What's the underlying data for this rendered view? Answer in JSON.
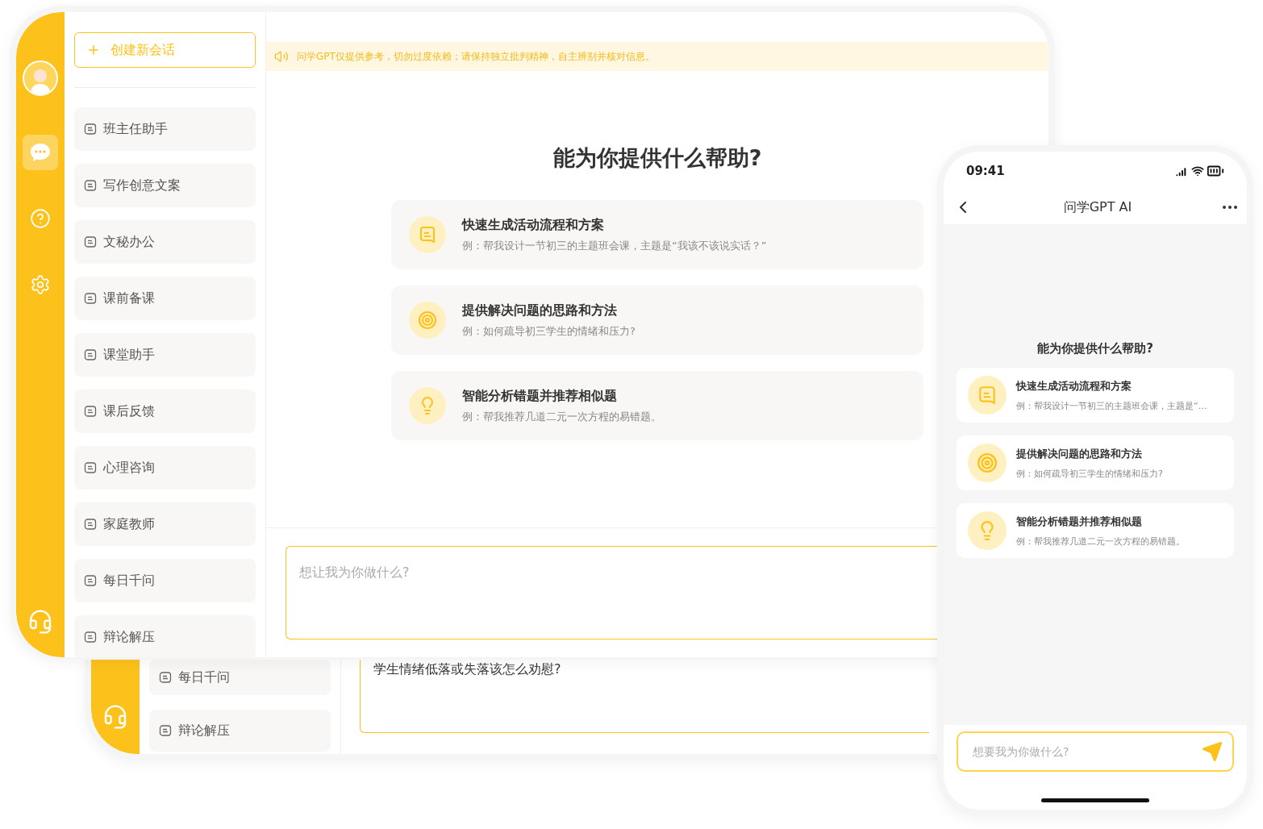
{
  "back_window": {
    "sidebar_items": [
      "每日千问",
      "辩论解压"
    ],
    "input": {
      "value": "学生情绪低落或失落该怎么劝慰?"
    }
  },
  "front_window": {
    "rail_buttons": [
      {
        "selected": true
      },
      {
        "selected": false
      },
      {
        "selected": false
      }
    ],
    "new_chat_button": "创建新会话",
    "sidebar_items": [
      "班主任助手",
      "写作创意文案",
      "文秘办公",
      "课前备课",
      "课堂助手",
      "课后反馈",
      "心理咨询",
      "家庭教师",
      "每日千问",
      "辩论解压"
    ],
    "notice": "问学GPT仅提供参考，切勿过度依赖；请保持独立批判精神，自主辨别并核对信息。",
    "heading": "能为你提供什么帮助?",
    "suggestions": [
      {
        "kind": "chat",
        "title": "快速生成活动流程和方案",
        "example": "例：帮我设计一节初三的主题班会课，主题是“我该不该说实话？”"
      },
      {
        "kind": "target",
        "title": "提供解决问题的思路和方法",
        "example": "例：如何疏导初三学生的情绪和压力?"
      },
      {
        "kind": "bulb",
        "title": "智能分析错题并推荐相似题",
        "example": "例：帮我推荐几道二元一次方程的易错题。"
      }
    ],
    "input": {
      "placeholder": "想让我为你做什么?"
    }
  },
  "phone": {
    "time": "09:41",
    "title": "问学GPT AI",
    "heading": "能为你提供什么帮助?",
    "suggestions": [
      {
        "kind": "chat",
        "title": "快速生成活动流程和方案",
        "example": "例：帮我设计一节初三的主题班会课，主题是“…"
      },
      {
        "kind": "target",
        "title": "提供解决问题的思路和方法",
        "example": "例：如何疏导初三学生的情绪和压力?"
      },
      {
        "kind": "bulb",
        "title": "智能分析错题并推荐相似题",
        "example": "例：帮我推荐几道二元一次方程的易错题。"
      }
    ],
    "input": {
      "placeholder": "想要我为你做什么?"
    }
  }
}
